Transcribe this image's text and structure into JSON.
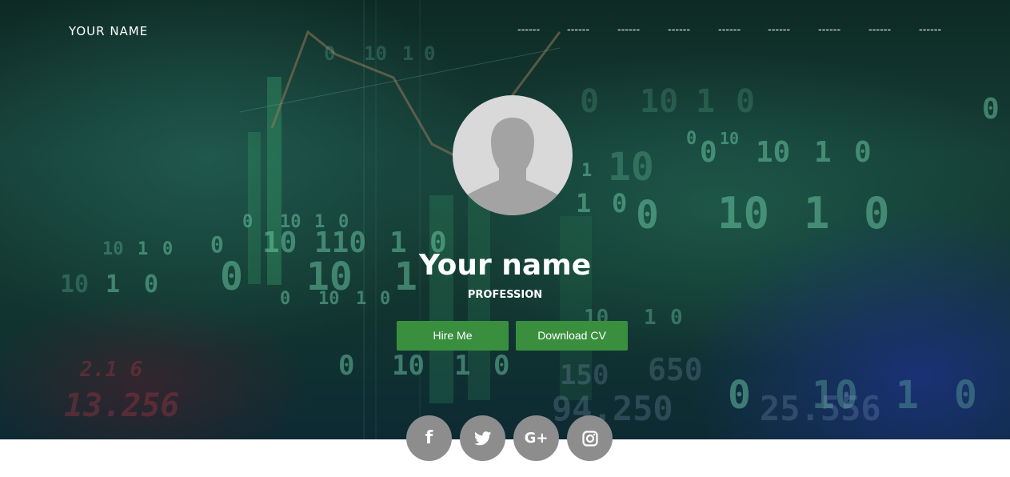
{
  "navbar": {
    "brand": "YOUR NAME",
    "links": [
      "------",
      "------",
      "------",
      "------",
      "------",
      "------",
      "------",
      "------",
      "------"
    ]
  },
  "profile": {
    "name": "Your name",
    "profession": "PROFESSION",
    "avatar_icon": "user-silhouette-icon"
  },
  "actions": {
    "hire_label": "Hire Me",
    "cv_label": "Download CV"
  },
  "social": [
    {
      "icon": "facebook-icon",
      "glyph": "f"
    },
    {
      "icon": "twitter-icon"
    },
    {
      "icon": "google-plus-icon",
      "glyph": "G+"
    },
    {
      "icon": "instagram-icon"
    }
  ],
  "colors": {
    "accent_button": "#3a8f3e",
    "social_circle": "#8d8d8d",
    "avatar_bg": "#d9d9d9",
    "silhouette": "#a3a3a3"
  }
}
